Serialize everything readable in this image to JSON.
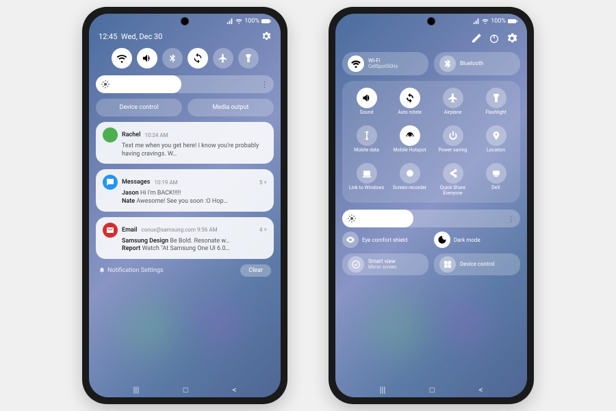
{
  "status": {
    "battery": "100%"
  },
  "left": {
    "time": "12:45",
    "date": "Wed, Dec 30",
    "chips": [
      "Device control",
      "Media output"
    ],
    "notifs": [
      {
        "sender": "Rachel",
        "time": "10:24 AM",
        "body": "Text me when you get here! I know you're probably having cravings. W…",
        "color": "#4caf50"
      },
      {
        "app": "Messages",
        "time": "10:19 AM",
        "count": "5",
        "lines": [
          {
            "n": "Jason",
            "t": "Hi I'm BACK!!!!!"
          },
          {
            "n": "Nate",
            "t": "Awesome! See you soon :O Hop…"
          }
        ],
        "color": "#2196f3"
      },
      {
        "app": "Email",
        "meta": "conux@samsung.com 9:56 AM",
        "count": "4",
        "lines": [
          {
            "n": "Samsung Design",
            "t": "Be Bold. Resonate w…"
          },
          {
            "n": "Report",
            "t": "Watch \"At Samsung One UI 6.0…"
          }
        ],
        "color": "#d32f2f"
      }
    ],
    "settings_label": "Notification Settings",
    "clear": "Clear"
  },
  "right": {
    "expanded": [
      {
        "label": "Wi-Fi",
        "sub": "CellSpot5GHz",
        "on": true,
        "icon": "wifi"
      },
      {
        "label": "Bluetooth",
        "sub": "",
        "on": false,
        "icon": "bt"
      }
    ],
    "grid": [
      {
        "label": "Sound",
        "on": true,
        "icon": "sound"
      },
      {
        "label": "Auto rotate",
        "on": true,
        "icon": "rotate"
      },
      {
        "label": "Airplane",
        "on": false,
        "icon": "plane"
      },
      {
        "label": "Flashlight",
        "on": false,
        "icon": "flash"
      },
      {
        "label": "Mobile data",
        "on": false,
        "icon": "data"
      },
      {
        "label": "Mobile Hotspot",
        "on": true,
        "icon": "hotspot"
      },
      {
        "label": "Power saving",
        "on": false,
        "icon": "power"
      },
      {
        "label": "Location",
        "on": false,
        "icon": "loc"
      },
      {
        "label": "Link to Windows",
        "on": false,
        "icon": "link"
      },
      {
        "label": "Screen recorder",
        "on": false,
        "icon": "rec"
      },
      {
        "label": "Quick Share Everyone",
        "on": false,
        "icon": "share"
      },
      {
        "label": "DeX",
        "on": false,
        "icon": "dex"
      }
    ],
    "modes": [
      {
        "label": "Eye comfort shield",
        "on": false,
        "icon": "eye"
      },
      {
        "label": "Dark mode",
        "on": true,
        "icon": "dark"
      }
    ],
    "bottom": [
      {
        "label": "Smart view",
        "sub": "Mirror screen",
        "icon": "smart"
      },
      {
        "label": "Device control",
        "sub": "",
        "icon": "grid"
      }
    ]
  }
}
